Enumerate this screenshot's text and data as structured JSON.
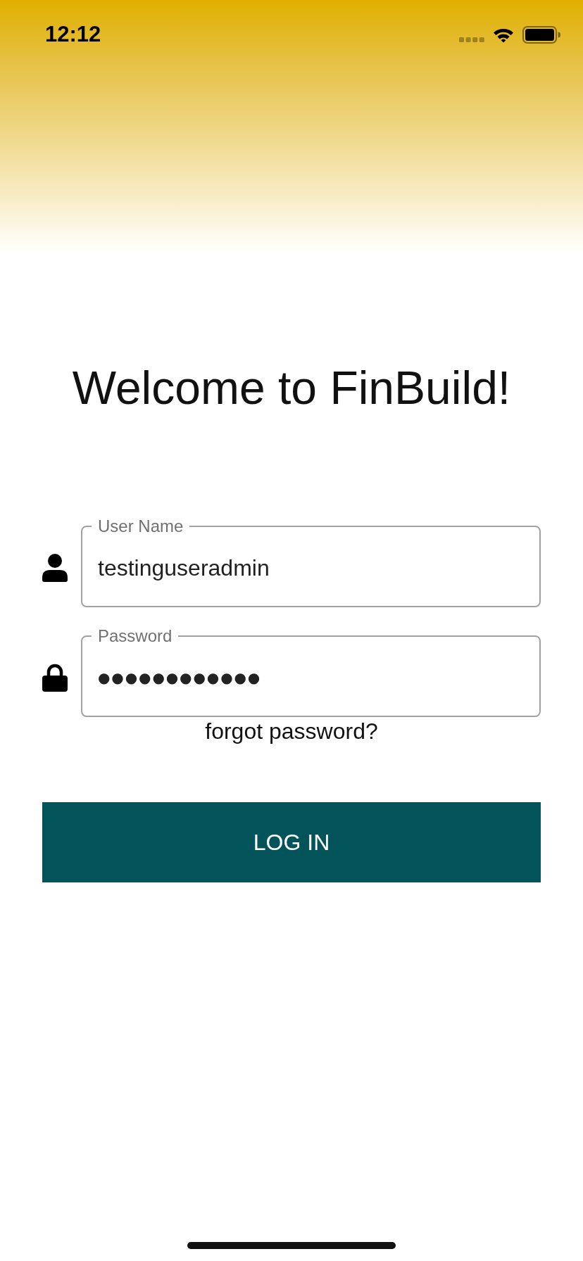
{
  "status_bar": {
    "time": "12:12"
  },
  "title": "Welcome to FinBuild!",
  "fields": [
    {
      "kind": "username",
      "label": "User Name",
      "value": "testinguseradmin"
    },
    {
      "kind": "password",
      "label": "Password",
      "value": "●●●●●●●●●●●●"
    }
  ],
  "forgot_link": "forgot password?",
  "login_button": "LOG IN"
}
